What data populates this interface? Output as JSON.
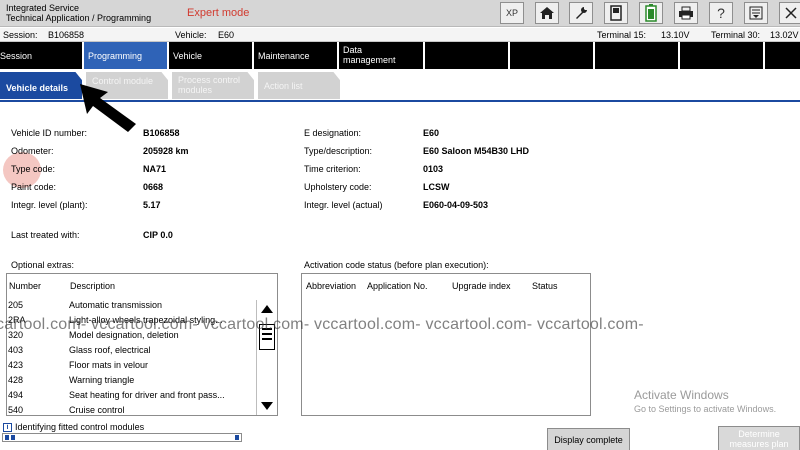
{
  "titlebar": {
    "line1": "Integrated Service",
    "line2": "Technical Application / Programming",
    "mode": "Expert mode",
    "buttons": [
      {
        "name": "xp-button",
        "label": "XP"
      },
      {
        "name": "home-button",
        "label": "⌂"
      },
      {
        "name": "wrench-button",
        "label": "🔧"
      },
      {
        "name": "phone-car-button",
        "label": "⚙"
      },
      {
        "name": "battery-button",
        "label": "▮"
      },
      {
        "name": "print-button",
        "label": "⎙"
      },
      {
        "name": "help-button",
        "label": "?"
      },
      {
        "name": "list-button",
        "label": "☰"
      },
      {
        "name": "close-button",
        "label": "✕"
      }
    ]
  },
  "infobar": {
    "session_label": "Session:",
    "session_value": "B106858",
    "vehicle_label": "Vehicle:",
    "vehicle_value": "E60",
    "terminal15_label": "Terminal 15:",
    "terminal15_value": "13.10V",
    "terminal30_label": "Terminal 30:",
    "terminal30_value": "13.02V"
  },
  "nav": {
    "tabs": [
      {
        "name": "tab-session",
        "label": "Session"
      },
      {
        "name": "tab-programming",
        "label": "Programming"
      },
      {
        "name": "tab-vehicle",
        "label": "Vehicle"
      },
      {
        "name": "tab-maintenance",
        "label": "Maintenance"
      },
      {
        "name": "tab-data-management",
        "label": "Data\nmanagement"
      }
    ]
  },
  "subtabs": [
    {
      "name": "subtab-vehicle-details",
      "label": "Vehicle details"
    },
    {
      "name": "subtab-control-module",
      "label": "Control module"
    },
    {
      "name": "subtab-process-control-modules",
      "label": "Process control\nmodules"
    },
    {
      "name": "subtab-action-list",
      "label": "Action list"
    }
  ],
  "details": {
    "vehicle_id_label": "Vehicle ID number:",
    "vehicle_id_value": "B106858",
    "odometer_label": "Odometer:",
    "odometer_value": "205928 km",
    "type_code_label": "Type code:",
    "type_code_value": "NA71",
    "paint_code_label": "Paint code:",
    "paint_code_value": "0668",
    "integr_plant_label": "Integr. level (plant):",
    "integr_plant_value": "5.17",
    "last_treated_label": "Last treated with:",
    "last_treated_value": "CIP 0.0",
    "e_designation_label": "E designation:",
    "e_designation_value": "E60",
    "type_desc_label": "Type/description:",
    "type_desc_value": "E60 Saloon M54B30 LHD",
    "time_criterion_label": "Time criterion:",
    "time_criterion_value": "0103",
    "upholstery_label": "Upholstery code:",
    "upholstery_value": "LCSW",
    "integr_actual_label": "Integr. level (actual)",
    "integr_actual_value": "E060-04-09-503"
  },
  "optional_extras": {
    "title": "Optional extras:",
    "columns": [
      "Number",
      "Description"
    ],
    "rows": [
      {
        "number": "205",
        "description": "Automatic transmission"
      },
      {
        "number": "2RA",
        "description": "Light-alloy wheels trapezoidal styling..."
      },
      {
        "number": "320",
        "description": "Model designation, deletion"
      },
      {
        "number": "403",
        "description": "Glass roof, electrical"
      },
      {
        "number": "423",
        "description": "Floor mats in velour"
      },
      {
        "number": "428",
        "description": "Warning triangle"
      },
      {
        "number": "494",
        "description": "Seat heating for driver and front pass..."
      },
      {
        "number": "540",
        "description": "Cruise control"
      }
    ]
  },
  "activation": {
    "title": "Activation code status (before plan execution):",
    "columns": [
      "Abbreviation",
      "Application No.",
      "Upgrade index",
      "Status"
    ]
  },
  "watermark": "cartool.com- vccartool.com- vccartool.com- vccartool.com- vccartool.com- vccartool.com-",
  "activate_windows": {
    "line1": "Activate Windows",
    "line2": "Go to Settings to activate Windows."
  },
  "statusbar": {
    "text": "Identifying fitted control modules",
    "progress": 0.03
  },
  "buttons": {
    "display_complete": "Display complete",
    "determine_measures": "Determine\nmeasures plan"
  },
  "colors": {
    "accent_blue": "#2f63b7",
    "active_subtab": "#1b4aa0",
    "expert_red": "#d13a2f"
  }
}
